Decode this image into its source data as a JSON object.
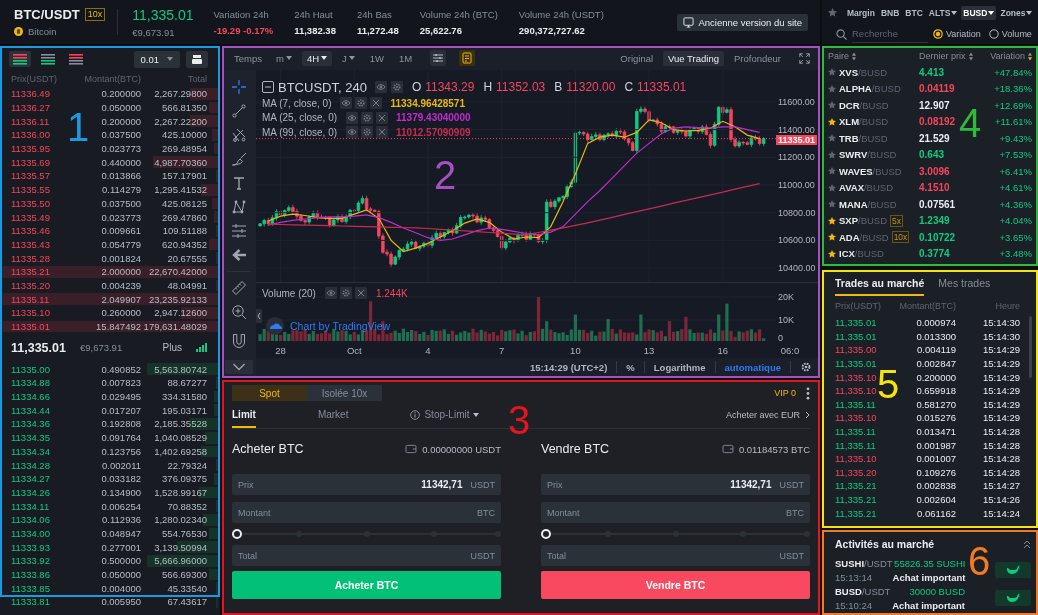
{
  "header": {
    "pair": "BTC/USDT",
    "leverage": "10x",
    "coin_name": "Bitcoin",
    "last_price": "11,335.01",
    "fiat_price": "€9,673.91",
    "stats": [
      {
        "label": "Variation 24h",
        "value": "-19.29 -0.17%",
        "color": "#f6465d"
      },
      {
        "label": "24h Haut",
        "value": "11,382.38",
        "color": "#eaecef"
      },
      {
        "label": "24h Bas",
        "value": "11,272.48",
        "color": "#eaecef"
      },
      {
        "label": "Volume 24h (BTC)",
        "value": "25,622.76",
        "color": "#eaecef"
      },
      {
        "label": "Volume 24h (USDT)",
        "value": "290,372,727.62",
        "color": "#eaecef"
      }
    ],
    "old_site_button": "Ancienne version du site"
  },
  "market_selector": {
    "tabs": [
      {
        "kind": "favorites",
        "selected": false
      },
      {
        "kind": "text",
        "label": "Margin",
        "dropdown": false,
        "selected": false
      },
      {
        "kind": "text",
        "label": "BNB",
        "dropdown": false,
        "selected": false
      },
      {
        "kind": "text",
        "label": "BTC",
        "dropdown": false,
        "selected": false
      },
      {
        "kind": "text",
        "label": "ALTS",
        "dropdown": true,
        "selected": false
      },
      {
        "kind": "text",
        "label": "BUSD",
        "dropdown": true,
        "selected": true
      },
      {
        "kind": "text",
        "label": "Zones",
        "dropdown": true,
        "selected": false
      }
    ],
    "search": {
      "placeholder": "Recherche"
    },
    "sort_options": [
      {
        "label": "Variation",
        "selected": true
      },
      {
        "label": "Volume",
        "selected": false
      }
    ]
  },
  "order_book": {
    "annotation": {
      "label": "1",
      "color": "#1b9ae4"
    },
    "view_modes": [
      {
        "kind": "both",
        "selected": true
      },
      {
        "kind": "bids",
        "selected": false
      },
      {
        "kind": "asks",
        "selected": false
      }
    ],
    "precision": "0.01",
    "columns": [
      "Prix(USDT)",
      "Montant(BTC)",
      "Total"
    ],
    "asks": [
      {
        "price": "11336.49",
        "amount": "0.200000",
        "total": "2,267.29800",
        "level": 0.13
      },
      {
        "price": "11336.27",
        "amount": "0.050000",
        "total": "566.81350",
        "level": 0.04
      },
      {
        "price": "11336.11",
        "amount": "0.200000",
        "total": "2,267.22200",
        "level": 0.13
      },
      {
        "price": "11336.00",
        "amount": "0.037500",
        "total": "425.10000",
        "level": 0.03
      },
      {
        "price": "11335.95",
        "amount": "0.023773",
        "total": "269.48954",
        "level": 0.02
      },
      {
        "price": "11335.69",
        "amount": "0.440000",
        "total": "4,987.70360",
        "level": 0.3
      },
      {
        "price": "11335.57",
        "amount": "0.013866",
        "total": "157.17901",
        "level": 0.01
      },
      {
        "price": "11335.55",
        "amount": "0.114279",
        "total": "1,295.41532",
        "level": 0.08
      },
      {
        "price": "11335.50",
        "amount": "0.037500",
        "total": "425.08125",
        "level": 0.03
      },
      {
        "price": "11335.49",
        "amount": "0.023773",
        "total": "269.47860",
        "level": 0.02
      },
      {
        "price": "11335.46",
        "amount": "0.009661",
        "total": "109.51188",
        "level": 0.01
      },
      {
        "price": "11335.43",
        "amount": "0.054779",
        "total": "620.94352",
        "level": 0.04
      },
      {
        "price": "11335.28",
        "amount": "0.001824",
        "total": "20.67555",
        "level": 0.01
      },
      {
        "price": "11335.21",
        "amount": "2.000000",
        "total": "22,670.42000",
        "level": 1
      },
      {
        "price": "11335.20",
        "amount": "0.004239",
        "total": "48.04991",
        "level": 0.01
      },
      {
        "price": "11335.11",
        "amount": "2.049907",
        "total": "23,235.92133",
        "level": 1
      },
      {
        "price": "11335.10",
        "amount": "0.260000",
        "total": "2,947.12600",
        "level": 0.17
      },
      {
        "price": "11335.01",
        "amount": "15.847492",
        "total": "179,631.48029",
        "level": 1
      }
    ],
    "last_price": "11,335.01",
    "fiat_price": "€9,673.91",
    "more_link": "Plus",
    "bids": [
      {
        "price": "11335.00",
        "amount": "0.490852",
        "total": "5,563.80742",
        "level": 0.33
      },
      {
        "price": "11334.88",
        "amount": "0.007823",
        "total": "88.67277",
        "level": 0.01
      },
      {
        "price": "11334.66",
        "amount": "0.029495",
        "total": "334.31580",
        "level": 0.02
      },
      {
        "price": "11334.44",
        "amount": "0.017207",
        "total": "195.03171",
        "level": 0.02
      },
      {
        "price": "11334.36",
        "amount": "0.192808",
        "total": "2,185.35528",
        "level": 0.13
      },
      {
        "price": "11334.35",
        "amount": "0.091764",
        "total": "1,040.08529",
        "level": 0.06
      },
      {
        "price": "11334.34",
        "amount": "0.123756",
        "total": "1,402.69258",
        "level": 0.08
      },
      {
        "price": "11334.28",
        "amount": "0.002011",
        "total": "22.79324",
        "level": 0.01
      },
      {
        "price": "11334.27",
        "amount": "0.033182",
        "total": "376.09375",
        "level": 0.02
      },
      {
        "price": "11334.26",
        "amount": "0.134900",
        "total": "1,528.99167",
        "level": 0.09
      },
      {
        "price": "11334.11",
        "amount": "0.006254",
        "total": "70.88352",
        "level": 0.01
      },
      {
        "price": "11334.06",
        "amount": "0.112936",
        "total": "1,280.02340",
        "level": 0.07
      },
      {
        "price": "11334.00",
        "amount": "0.048947",
        "total": "554.76530",
        "level": 0.04
      },
      {
        "price": "11333.93",
        "amount": "0.277001",
        "total": "3,139.50994",
        "level": 0.19
      },
      {
        "price": "11333.92",
        "amount": "0.500000",
        "total": "5,666.96000",
        "level": 0.33
      },
      {
        "price": "11333.86",
        "amount": "0.050000",
        "total": "566.69300",
        "level": 0.04
      },
      {
        "price": "11333.85",
        "amount": "0.004000",
        "total": "45.33540",
        "level": 0.01
      },
      {
        "price": "11333.81",
        "amount": "0.005950",
        "total": "67.43617",
        "level": 0.01
      }
    ]
  },
  "chart": {
    "annotation": {
      "label": "2",
      "color": "#a94fc4"
    },
    "interval_label": "Temps",
    "intervals": [
      {
        "label": "m",
        "dropdown": true,
        "selected": false
      },
      {
        "label": "4H",
        "dropdown": true,
        "selected": true
      },
      {
        "label": "J",
        "dropdown": true,
        "selected": false
      },
      {
        "label": "1W",
        "dropdown": false,
        "selected": false
      },
      {
        "label": "1M",
        "dropdown": false,
        "selected": false
      }
    ],
    "views": [
      {
        "label": "Original",
        "selected": false
      },
      {
        "label": "Vue Trading",
        "selected": true
      },
      {
        "label": "Profondeur",
        "selected": false
      }
    ],
    "drawing_tools": [
      {
        "kind": "crosshair",
        "selected": true
      },
      {
        "kind": "trend_line",
        "selected": false
      },
      {
        "kind": "pitchfork",
        "selected": false
      },
      {
        "kind": "brush",
        "selected": false
      },
      {
        "kind": "text",
        "selected": false
      },
      {
        "kind": "pattern",
        "selected": false
      },
      {
        "kind": "position",
        "selected": false
      },
      {
        "kind": "back",
        "selected": false
      },
      {
        "kind": "ruler",
        "selected": false
      },
      {
        "kind": "zoom",
        "selected": false
      },
      {
        "kind": "magnet",
        "selected": false
      },
      {
        "kind": "collapse",
        "selected": false
      }
    ],
    "symbol": "BTCUSDT, 240",
    "ohlc": [
      {
        "key": "O",
        "value": "11343.29"
      },
      {
        "key": "H",
        "value": "11352.03"
      },
      {
        "key": "B",
        "value": "11320.00"
      },
      {
        "key": "C",
        "value": "11335.01"
      }
    ],
    "indicator_values": [
      "11334.96428571",
      "11379.43040000",
      "11012.57090909"
    ],
    "chart_data": {
      "type": "line",
      "grid": true,
      "categories": [
        null,
        "28",
        null,
        null,
        null,
        null,
        null,
        "Oct",
        null,
        null,
        null,
        null,
        null,
        "4",
        null,
        null,
        null,
        null,
        null,
        "7",
        null,
        null,
        null,
        null,
        null,
        "10",
        null,
        null,
        null,
        null,
        null,
        "13",
        null,
        null,
        null,
        null,
        null,
        "16",
        null,
        null,
        null
      ],
      "ylim": [
        10300,
        11830
      ],
      "yticks": [
        {
          "value": 11600,
          "label": "11600.00"
        },
        {
          "value": 11400,
          "label": "11400.00"
        },
        {
          "value": 11200,
          "label": "11200.00"
        },
        {
          "value": 11000,
          "label": "11000.00"
        },
        {
          "value": 10800,
          "label": "10800.00"
        },
        {
          "value": 10600,
          "label": "10600.00"
        },
        {
          "value": 10400,
          "label": "10400.00"
        }
      ],
      "series": [
        {
          "name": "MA (7, close, 0)",
          "color": "#e8b90e",
          "values": [
            10740,
            10775,
            10790,
            10780,
            10765,
            10760,
            10760,
            10790,
            10820,
            10760,
            10600,
            10520,
            10545,
            10580,
            10625,
            10670,
            10725,
            10755,
            10730,
            10660,
            10610,
            10625,
            10620,
            10700,
            10880,
            11080,
            11300,
            11345,
            11360,
            11345,
            11380,
            11470,
            11450,
            11400,
            11390,
            11395,
            11410,
            11460,
            11420,
            11360,
            11335
          ]
        },
        {
          "name": "MA (25, close, 0)",
          "color": "#c12ccc",
          "values": [
            10710,
            10730,
            10745,
            10755,
            10765,
            10770,
            10770,
            10775,
            10785,
            10765,
            10730,
            10690,
            10655,
            10620,
            10600,
            10610,
            10640,
            10670,
            10690,
            10680,
            10665,
            10650,
            10640,
            10660,
            10700,
            10790,
            10880,
            10960,
            11050,
            11140,
            11230,
            11300,
            11370,
            11410,
            11420,
            11415,
            11410,
            11420,
            11420,
            11400,
            11380
          ]
        },
        {
          "name": "MA (99, close, 0)",
          "color": "#c42d52",
          "values": [
            10718,
            10715,
            10713,
            10711,
            10709,
            10706,
            10704,
            10702,
            10700,
            10698,
            10695,
            10693,
            10691,
            10686,
            10680,
            10675,
            10669,
            10663,
            10657,
            10652,
            10646,
            10640,
            10657,
            10674,
            10691,
            10709,
            10727,
            10747,
            10767,
            10788,
            10808,
            10828,
            10848,
            10869,
            10889,
            10909,
            10929,
            10949,
            10970,
            10990,
            11010
          ]
        }
      ]
    },
    "time_axis_end_label": "06:0",
    "current_price": "11335.01",
    "volume": {
      "label": "Volume (20)",
      "value": "1.244K",
      "ticks": [
        "20K",
        "10K",
        "0"
      ]
    },
    "attribution": "Chart by TradingView",
    "status": {
      "time": "15:14:29 (UTC+2)",
      "scale_options": [
        {
          "label": "%",
          "selected": false
        },
        {
          "label": "Logarithme",
          "selected": false
        },
        {
          "label": "automatique",
          "selected": true
        }
      ]
    }
  },
  "order_form": {
    "annotation": {
      "label": "3",
      "color": "#e3151f"
    },
    "modes": [
      {
        "label": "Spot",
        "selected": true
      },
      {
        "label": "Isolée 10x",
        "selected": false
      }
    ],
    "vip": "VIP 0",
    "order_types": [
      {
        "kind": "plain",
        "label": "Limit",
        "selected": true
      },
      {
        "kind": "plain",
        "label": "Market",
        "selected": false
      },
      {
        "kind": "menu",
        "label": "Stop-Limit",
        "selected": false
      }
    ],
    "buy_with": "Acheter avec EUR",
    "sides": [
      {
        "kind": "buy",
        "title": "Acheter BTC",
        "balance": "0.00000000 USDT",
        "inputs": [
          {
            "kind": "field",
            "label": "Prix",
            "value": "11342,71",
            "unit": "USDT"
          },
          {
            "kind": "field",
            "label": "Montant",
            "unit": "BTC"
          },
          {
            "kind": "slider",
            "level": 0
          },
          {
            "kind": "field",
            "label": "Total",
            "unit": "USDT"
          }
        ],
        "button": "Acheter BTC"
      },
      {
        "kind": "sell",
        "title": "Vendre BTC",
        "balance": "0.01184573 BTC",
        "inputs": [
          {
            "kind": "field",
            "label": "Prix",
            "value": "11342,71",
            "unit": "USDT"
          },
          {
            "kind": "field",
            "label": "Montant",
            "unit": "BTC"
          },
          {
            "kind": "slider",
            "level": 0
          },
          {
            "kind": "field",
            "label": "Total",
            "unit": "USDT"
          }
        ],
        "button": "Vendre BTC"
      }
    ]
  },
  "pairs": {
    "annotation": {
      "label": "4",
      "color": "#2dbb3b"
    },
    "columns": [
      {
        "label": "Paire",
        "sorted": false
      },
      {
        "label": "Dernier prix",
        "sorted": false
      },
      {
        "label": "Variation",
        "sorted": true
      }
    ],
    "rows": [
      {
        "favorite": false,
        "base": "XVS",
        "quote": "/BUSD",
        "price": "4.413",
        "color": "#0ecb81",
        "change": "+47.84%"
      },
      {
        "favorite": false,
        "base": "ALPHA",
        "quote": "/BUSD",
        "price": "0.04119",
        "color": "#f6465d",
        "change": "+18.36%"
      },
      {
        "favorite": false,
        "base": "DCR",
        "quote": "/BUSD",
        "price": "12.907",
        "color": "#eaecef",
        "change": "+12.69%"
      },
      {
        "favorite": true,
        "base": "XLM",
        "quote": "/BUSD",
        "price": "0.08192",
        "color": "#f6465d",
        "change": "+11.61%"
      },
      {
        "favorite": false,
        "base": "TRB",
        "quote": "/BUSD",
        "price": "21.529",
        "color": "#eaecef",
        "change": "+9.43%"
      },
      {
        "favorite": false,
        "base": "SWRV",
        "quote": "/BUSD",
        "price": "0.643",
        "color": "#0ecb81",
        "change": "+7.53%"
      },
      {
        "favorite": false,
        "base": "WAVES",
        "quote": "/BUSD",
        "price": "3.0096",
        "color": "#f6465d",
        "change": "+6.41%"
      },
      {
        "favorite": false,
        "base": "AVAX",
        "quote": "/BUSD",
        "price": "4.1510",
        "color": "#f6465d",
        "change": "+4.61%"
      },
      {
        "favorite": false,
        "base": "MANA",
        "quote": "/BUSD",
        "price": "0.07561",
        "color": "#eaecef",
        "change": "+4.36%"
      },
      {
        "favorite": true,
        "base": "SXP",
        "quote": "/BUSD",
        "leverage": "5x",
        "price": "1.2349",
        "color": "#0ecb81",
        "change": "+4.04%"
      },
      {
        "favorite": true,
        "base": "ADA",
        "quote": "/BUSD",
        "leverage": "10x",
        "price": "0.10722",
        "color": "#0ecb81",
        "change": "+3.65%"
      },
      {
        "favorite": true,
        "base": "ICX",
        "quote": "/BUSD",
        "price": "0.3774",
        "color": "#0ecb81",
        "change": "+3.48%"
      }
    ]
  },
  "trades": {
    "annotation": {
      "label": "5",
      "color": "#f4e40c"
    },
    "tabs": [
      {
        "label": "Trades au marché",
        "selected": true
      },
      {
        "label": "Mes trades",
        "selected": false
      }
    ],
    "columns": [
      "Prix(USDT)",
      "Montant(BTC)",
      "Heure"
    ],
    "rows": [
      {
        "kind": "buy",
        "price": "11,335.01",
        "amount": "0.000974",
        "time": "15:14:30"
      },
      {
        "kind": "buy",
        "price": "11,335.01",
        "amount": "0.013300",
        "time": "15:14:30"
      },
      {
        "kind": "sell",
        "price": "11,335.00",
        "amount": "0.004119",
        "time": "15:14:29"
      },
      {
        "kind": "buy",
        "price": "11,335.01",
        "amount": "0.002847",
        "time": "15:14:29"
      },
      {
        "kind": "sell",
        "price": "11,335.10",
        "amount": "0.200000",
        "time": "15:14:29"
      },
      {
        "kind": "sell",
        "price": "11,335.10",
        "amount": "0.659918",
        "time": "15:14:29"
      },
      {
        "kind": "buy",
        "price": "11,335.11",
        "amount": "0.581270",
        "time": "15:14:29"
      },
      {
        "kind": "sell",
        "price": "11,335.10",
        "amount": "0.015276",
        "time": "15:14:29"
      },
      {
        "kind": "buy",
        "price": "11,335.11",
        "amount": "0.013471",
        "time": "15:14:28"
      },
      {
        "kind": "buy",
        "price": "11,335.11",
        "amount": "0.001987",
        "time": "15:14:28"
      },
      {
        "kind": "sell",
        "price": "11,335.10",
        "amount": "0.001007",
        "time": "15:14:28"
      },
      {
        "kind": "sell",
        "price": "11,335.20",
        "amount": "0.109276",
        "time": "15:14:28"
      },
      {
        "kind": "buy",
        "price": "11,335.21",
        "amount": "0.002838",
        "time": "15:14:27"
      },
      {
        "kind": "buy",
        "price": "11,335.21",
        "amount": "0.002604",
        "time": "15:14:26"
      },
      {
        "kind": "buy",
        "price": "11,335.21",
        "amount": "0.061162",
        "time": "15:14:24"
      }
    ]
  },
  "market_activity": {
    "annotation": {
      "label": "6",
      "color": "#f47920"
    },
    "title": "Activités au marché",
    "items": [
      {
        "base": "SUSHI",
        "quote": "/USDT",
        "time": "15:13:14",
        "amount": "55826.35 SUSHI",
        "label": "Achat important"
      },
      {
        "base": "BUSD",
        "quote": "/USDT",
        "time": "15:10:24",
        "amount": "30000 BUSD",
        "label": "Achat important"
      }
    ]
  }
}
